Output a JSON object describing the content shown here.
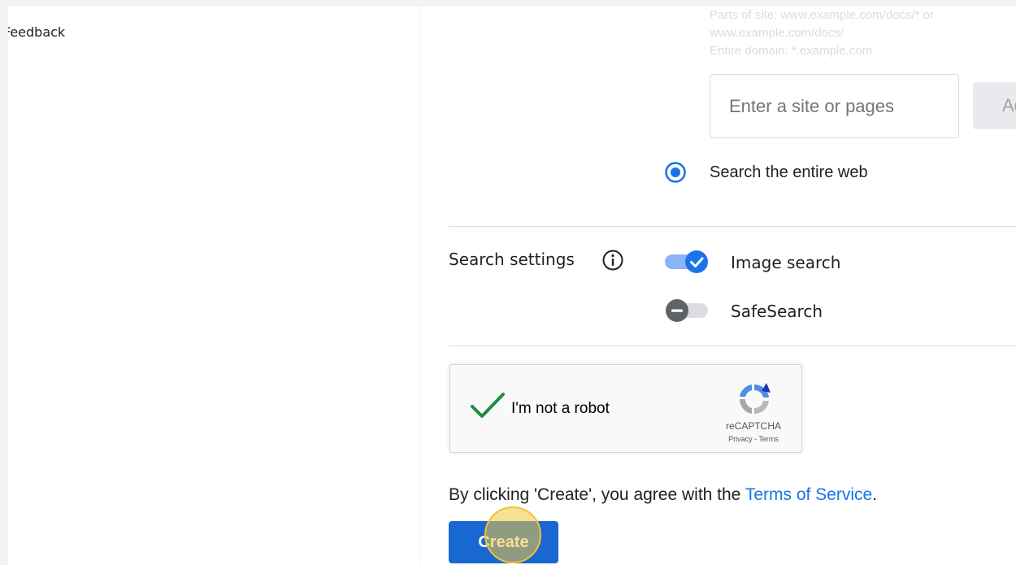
{
  "sidebar": {
    "feedback_label": "Feedback"
  },
  "sites": {
    "hint_line_1": "Parts of site: www.example.com/docs/* or",
    "hint_line_2": "www.example.com/docs/",
    "hint_line_3": "Entire domain: *.example.com",
    "input_placeholder": "Enter a site or pages",
    "add_label": "Add",
    "search_entire_web_label": "Search the entire web",
    "search_entire_web_selected": true
  },
  "search_settings": {
    "label": "Search settings",
    "image_search_label": "Image search",
    "image_search_on": true,
    "safesearch_label": "SafeSearch",
    "safesearch_on": false
  },
  "recaptcha": {
    "label": "I'm not a robot",
    "brand": "reCAPTCHA",
    "links": "Privacy - Terms"
  },
  "consent": {
    "prefix": "By clicking 'Create', you agree with the ",
    "link": "Terms of Service",
    "suffix": "."
  },
  "create_label": "Create",
  "colors": {
    "accent": "#1a73e8",
    "button": "#1967d2",
    "check": "#1e8e3e",
    "highlight": "#f2c230"
  }
}
